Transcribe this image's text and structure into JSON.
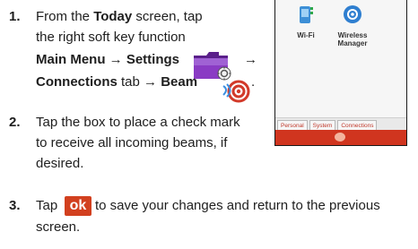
{
  "step1": {
    "number": "1.",
    "l1_pre": "From the ",
    "l1_bold": "Today",
    "l1_post": " screen, tap",
    "l2": "the right soft key function",
    "l3": "Main Menu → Settings",
    "l3_arrow": "→",
    "l4_bold1": "Connections",
    "l4_mid": " tab ",
    "l4_bold2": "→ Beam",
    "l4_end": "."
  },
  "step2": {
    "number": "2.",
    "l1": "Tap the box to place a check mark",
    "l2": "to receive all incoming beams, if",
    "l3": "desired."
  },
  "step3": {
    "number": "3.",
    "l1_pre": "Tap ",
    "ok_label": "ok",
    "l1_post": " to save your changes and return to the previous",
    "l2": "screen."
  },
  "phone": {
    "apps": [
      {
        "label": "Wi-Fi",
        "icon": "wifi-icon"
      },
      {
        "label": "Wireless\nManager",
        "icon": "wireless-manager-icon"
      }
    ],
    "tabs": [
      "Personal",
      "System",
      "Connections"
    ]
  },
  "colors": {
    "ok_button": "#d2401f",
    "bottom_bar": "#d0351f",
    "folder": "#7b2fb3"
  }
}
